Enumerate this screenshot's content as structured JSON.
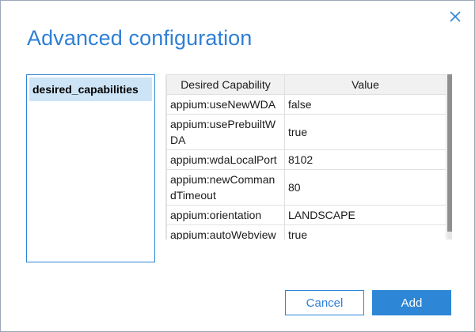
{
  "dialog": {
    "title": "Advanced configuration",
    "close_icon": "close-icon"
  },
  "categories": {
    "items": [
      {
        "label": "desired_capabilities",
        "selected": true
      }
    ]
  },
  "table": {
    "headers": [
      "Desired Capability",
      "Value"
    ],
    "rows": [
      {
        "capability": "appium:useNewWDA",
        "value": "false"
      },
      {
        "capability": "appium:usePrebuiltWDA",
        "value": "true"
      },
      {
        "capability": "appium:wdaLocalPort",
        "value": "8102"
      },
      {
        "capability": "appium:newCommandTimeout",
        "value": "80"
      },
      {
        "capability": "appium:orientation",
        "value": "LANDSCAPE"
      },
      {
        "capability": "appium:autoWebview",
        "value": "true"
      }
    ]
  },
  "buttons": {
    "cancel": "Cancel",
    "add": "Add"
  },
  "colors": {
    "accent": "#2e86d6",
    "title": "#2f7fd6",
    "selection": "#cde4f7"
  }
}
